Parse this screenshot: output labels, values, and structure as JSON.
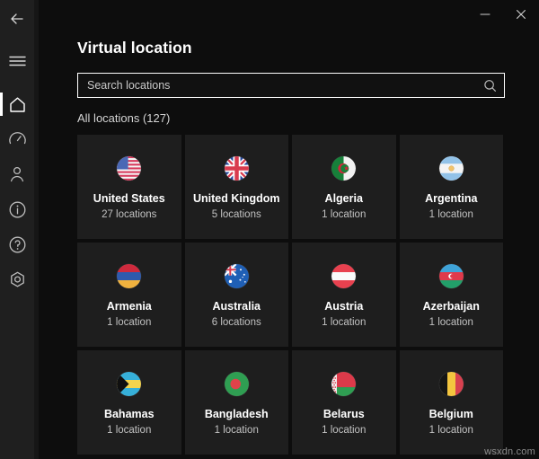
{
  "window": {
    "minimize_label": "Minimize",
    "close_label": "Close"
  },
  "sidebar": {
    "items": [
      {
        "name": "back",
        "label": "Back",
        "icon": "arrow-left-icon",
        "selected": false
      },
      {
        "name": "menu",
        "label": "Menu",
        "icon": "hamburger-menu-icon",
        "selected": false
      },
      {
        "name": "home",
        "label": "Home",
        "icon": "home-icon",
        "selected": true
      },
      {
        "name": "speed",
        "label": "Speed test",
        "icon": "gauge-icon",
        "selected": false
      },
      {
        "name": "account",
        "label": "Account",
        "icon": "person-icon",
        "selected": false
      },
      {
        "name": "about",
        "label": "About",
        "icon": "info-circle-icon",
        "selected": false
      },
      {
        "name": "help",
        "label": "Help",
        "icon": "question-circle-icon",
        "selected": false
      },
      {
        "name": "settings",
        "label": "Settings",
        "icon": "settings-hexagon-icon",
        "selected": false
      }
    ]
  },
  "header": {
    "title": "Virtual location"
  },
  "search": {
    "placeholder": "Search locations",
    "value": "",
    "icon": "search-icon"
  },
  "section": {
    "label": "All locations (127)",
    "total": 127
  },
  "locations": [
    {
      "country": "United States",
      "count_label": "27 locations",
      "count": 27,
      "flag": "us"
    },
    {
      "country": "United Kingdom",
      "count_label": "5 locations",
      "count": 5,
      "flag": "gb"
    },
    {
      "country": "Algeria",
      "count_label": "1 location",
      "count": 1,
      "flag": "dz"
    },
    {
      "country": "Argentina",
      "count_label": "1 location",
      "count": 1,
      "flag": "ar"
    },
    {
      "country": "Armenia",
      "count_label": "1 location",
      "count": 1,
      "flag": "am"
    },
    {
      "country": "Australia",
      "count_label": "6 locations",
      "count": 6,
      "flag": "au"
    },
    {
      "country": "Austria",
      "count_label": "1 location",
      "count": 1,
      "flag": "at"
    },
    {
      "country": "Azerbaijan",
      "count_label": "1 location",
      "count": 1,
      "flag": "az"
    },
    {
      "country": "Bahamas",
      "count_label": "1 location",
      "count": 1,
      "flag": "bs"
    },
    {
      "country": "Bangladesh",
      "count_label": "1 location",
      "count": 1,
      "flag": "bd"
    },
    {
      "country": "Belarus",
      "count_label": "1 location",
      "count": 1,
      "flag": "by"
    },
    {
      "country": "Belgium",
      "count_label": "1 location",
      "count": 1,
      "flag": "be"
    }
  ],
  "watermark": {
    "text": "wsxdn.com"
  },
  "colors": {
    "page_background": "#0d0d0d",
    "sidebar_background": "#1f1f1f",
    "card_background": "#1e1e1e",
    "accent": "#ffffff",
    "muted_text": "#c2c2c2"
  }
}
